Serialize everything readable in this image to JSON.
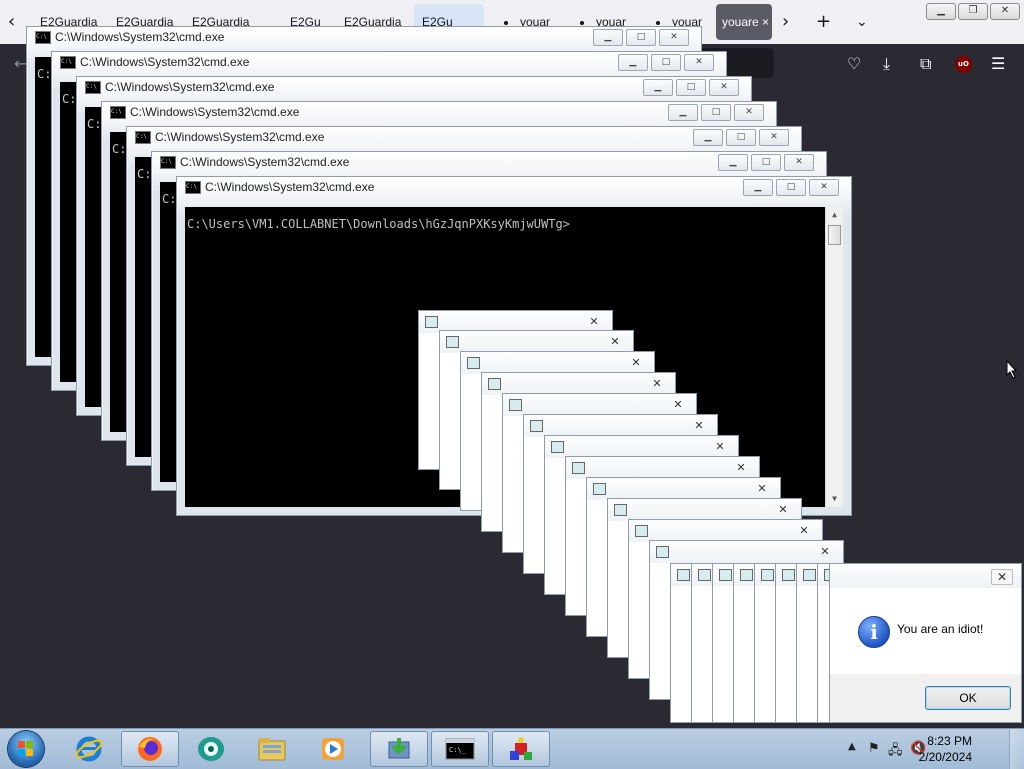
{
  "browser": {
    "tabs": [
      {
        "label": "E2Guardia"
      },
      {
        "label": "E2Guardia"
      },
      {
        "label": "E2Guardia"
      },
      {
        "label": "E2Gu"
      },
      {
        "label": "E2Guardia"
      },
      {
        "label": "E2Gu"
      },
      {
        "label": "youar"
      },
      {
        "label": "youar"
      },
      {
        "label": "youar"
      },
      {
        "label": "youare"
      }
    ]
  },
  "cmd_windows": [
    {
      "title": "C:\\Windows\\System32\\cmd.exe",
      "visible_text": "C:"
    },
    {
      "title": "C:\\Windows\\System32\\cmd.exe",
      "visible_text": "C:"
    },
    {
      "title": "C:\\Windows\\System32\\cmd.exe",
      "visible_text": "C:"
    },
    {
      "title": "C:\\Windows\\System32\\cmd.exe",
      "visible_text": "C:"
    },
    {
      "title": "C:\\Windows\\System32\\cmd.exe",
      "visible_text": "C:"
    },
    {
      "title": "C:\\Windows\\System32\\cmd.exe",
      "visible_text": "C:"
    },
    {
      "title": "C:\\Windows\\System32\\cmd.exe",
      "visible_text": "C:"
    },
    {
      "title": "C:\\Windows\\System32\\cmd.exe",
      "visible_text": "C:\\Users\\VM1.COLLABNET\\Downloads\\hGzJqnPXKsyKmjwUWTg>"
    }
  ],
  "dialog": {
    "message": "You are an idiot!",
    "ok_label": "OK"
  },
  "taskbar": {
    "time": "8:23 PM",
    "date": "2/20/2024"
  }
}
